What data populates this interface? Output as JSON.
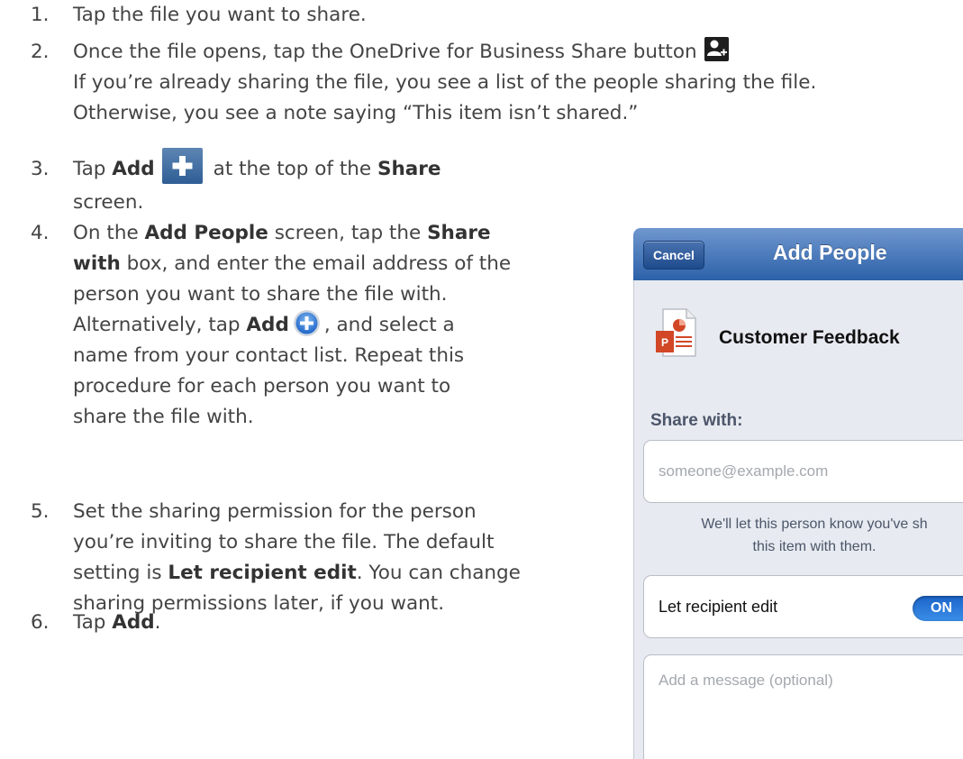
{
  "steps": [
    {
      "num": "1.",
      "line1": "Tap the file you want to share."
    },
    {
      "num": "2.",
      "line1": "Once the file opens, tap the OneDrive for Business Share button",
      "line2": "If you’re already sharing the file, you see a list of the people sharing the file.",
      "line3": "Otherwise, you see a note saying “This item isn’t shared.”"
    },
    {
      "num": "3.",
      "t1": "Tap ",
      "b1": "Add",
      "t2": "at the top of the ",
      "b2": "Share",
      "line2": "screen."
    },
    {
      "num": "4.",
      "l1_t1": "On the ",
      "l1_b1": "Add People",
      "l1_t2": " screen, tap the ",
      "l1_b2": "Share",
      "l2_b1": "with",
      "l2_t1": " box, and enter the email address of the",
      "l3": "person you want to share the file with.",
      "l4_t1": "Alternatively, tap ",
      "l4_b1": "Add",
      "l4_t2": ", and select a",
      "l5": "name from your contact list. Repeat this",
      "l6": "procedure for each person you want to",
      "l7": "share the file with."
    },
    {
      "num": "5.",
      "l1": "Set the sharing permission for the person",
      "l2": "you’re inviting to share the file. The default",
      "l3_t1": "setting is ",
      "l3_b1": "Let recipient edit",
      "l3_t2": ". You can change",
      "l4": "sharing permissions later, if you want."
    },
    {
      "num": "6.",
      "t1": "Tap ",
      "b1": "Add",
      "t2": "."
    }
  ],
  "phone": {
    "cancel_label": "Cancel",
    "title": "Add People",
    "file_name": "Customer Feedback",
    "share_label": "Share with:",
    "email_placeholder": "someone@example.com",
    "note_line1": "We'll let this person know you've sh",
    "note_line2": "this item with them.",
    "edit_label": "Let recipient edit",
    "toggle_label": "ON",
    "message_placeholder": "Add a message (optional)"
  },
  "icons": {
    "share": "share-person-icon",
    "add_square": "add-plus-icon",
    "add_circle": "add-circle-icon",
    "file": "powerpoint-file-icon"
  },
  "colors": {
    "text": "#444444",
    "header_blue": "#2c61a8",
    "toggle_blue": "#1c64c8",
    "powerpoint_orange": "#d24726"
  }
}
